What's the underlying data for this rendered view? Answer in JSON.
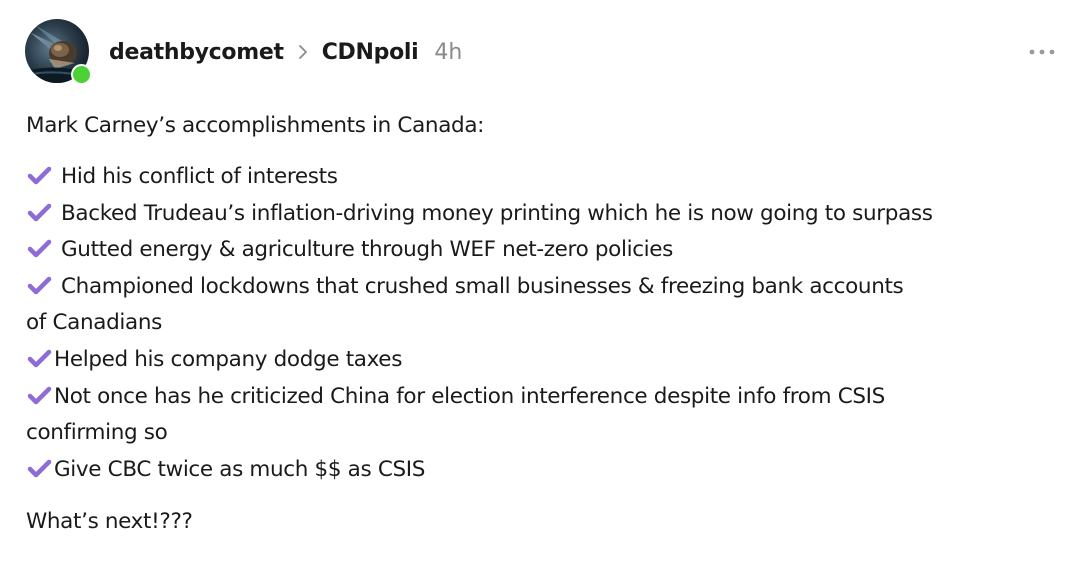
{
  "post": {
    "author": "deathbycomet",
    "community": "CDNpoli",
    "time": "4h",
    "intro": "Mark Carney’s accomplishments in Canada:",
    "items": [
      {
        "text": "Hid his conflict of interests"
      },
      {
        "text": "Backed Trudeau’s inflation-driving money printing which he is now going to surpass"
      },
      {
        "text": "Gutted energy & agriculture through WEF net-zero policies"
      },
      {
        "text": "Championed lockdowns that crushed small businesses & freezing bank accounts",
        "cont": "of Canadians"
      },
      {
        "text": "Helped his company dodge taxes"
      },
      {
        "text": "Not once has he criticized China for election interference despite info from CSIS",
        "cont": "confirming so"
      },
      {
        "text": "Give CBC twice as much $$ as CSIS"
      }
    ],
    "outro": "What’s next!???"
  },
  "icons": {
    "avatar": "comet-avatar",
    "online": "online-status-dot",
    "separator": "chevron-right-icon",
    "check": "check-mark-icon",
    "more": "more-options-icon"
  },
  "colors": {
    "text": "#1a1a1a",
    "muted": "#8a8a8a",
    "online": "#4cd137",
    "check": "#8e6bd6"
  }
}
